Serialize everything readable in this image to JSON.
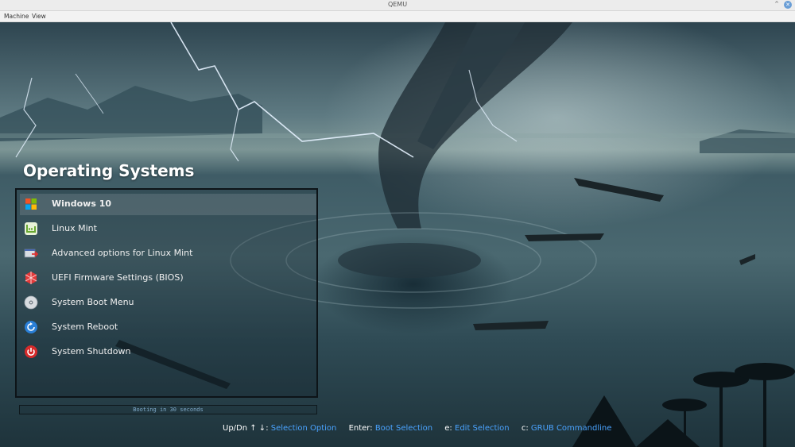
{
  "window": {
    "title": "QEMU"
  },
  "menubar": [
    "Machine",
    "View"
  ],
  "boot_menu": {
    "heading": "Operating Systems",
    "selected_index": 0,
    "entries": [
      {
        "label": "Windows 10",
        "icon": "windows-icon"
      },
      {
        "label": "Linux Mint",
        "icon": "linux-mint-icon"
      },
      {
        "label": "Advanced options for Linux Mint",
        "icon": "advanced-options-icon"
      },
      {
        "label": "UEFI Firmware Settings (BIOS)",
        "icon": "uefi-firmware-icon"
      },
      {
        "label": "System Boot Menu",
        "icon": "boot-disc-icon"
      },
      {
        "label": "System Reboot",
        "icon": "reboot-icon"
      },
      {
        "label": "System Shutdown",
        "icon": "power-icon"
      }
    ]
  },
  "countdown": {
    "text": "Booting in 30 seconds",
    "progress": 0.0
  },
  "help": {
    "nav_key": "Up/Dn ↑ ↓:",
    "nav_action": "Selection Option",
    "enter_key": "Enter:",
    "enter_action": "Boot Selection",
    "edit_key": "e:",
    "edit_action": "Edit Selection",
    "cmd_key": "c:",
    "cmd_action": "GRUB Commandline"
  },
  "colors": {
    "accent": "#4aa3ff",
    "menu_border": "#0d1418",
    "heading": "#ffffff"
  }
}
